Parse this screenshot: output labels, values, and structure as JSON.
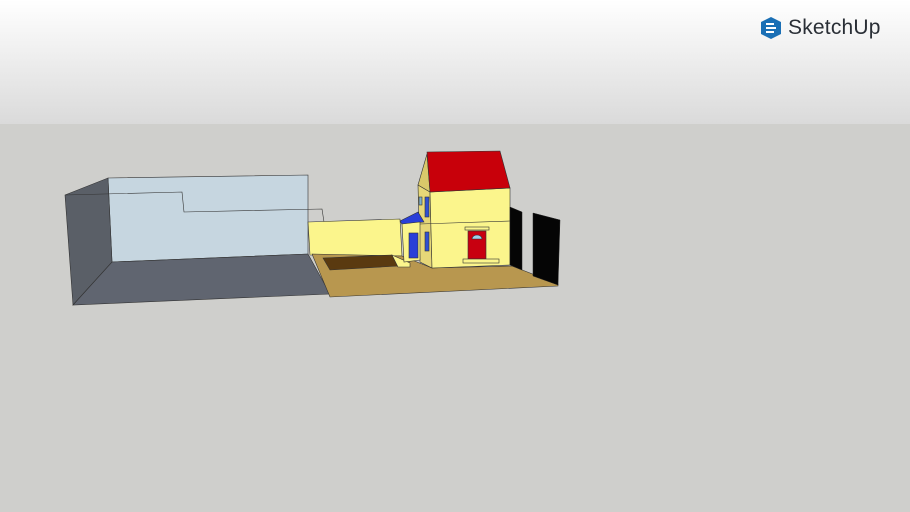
{
  "brand": {
    "name": "SketchUp",
    "icon": "sketchup-logo-icon",
    "color": "#1a6fb5"
  },
  "scene": {
    "description_colors": {
      "sky_top": "#ffffff",
      "sky_bottom": "#dcdcdc",
      "ground": "#cfcfcc",
      "roof": "#c8000a",
      "house_wall": "#fbf58c",
      "terrace": "#b8974f",
      "accent_blue": "#1f3fd8"
    }
  }
}
